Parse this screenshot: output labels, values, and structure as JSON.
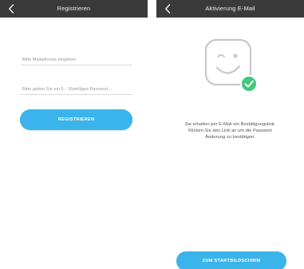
{
  "register_screen": {
    "title": "Registrieren",
    "email_placeholder": "Bitte Mailadresse eingeben",
    "password_placeholder": "Bitte geben Sie ein 6 - 16stelliges Passwort...",
    "register_button": "REGISTRIEREN"
  },
  "activation_screen": {
    "title": "Aktivierung E-Mail",
    "message_lines": [
      "Sie erhalten per E-Mail ein Bestätigungslink.",
      "Klicken Sie den Link an um die Passwort",
      "Änderung zu bestätigen."
    ],
    "home_button": "ZUM STARTBILDSCHIRM"
  },
  "colors": {
    "topbar": "#3a3a3a",
    "accent": "#3ab4ea",
    "success": "#3fc97a",
    "illustration_stroke": "#c8c8c8"
  },
  "icons": {
    "back": "chevron-left-icon",
    "illustration": "winking-face-icon",
    "success": "check-circle-icon"
  }
}
